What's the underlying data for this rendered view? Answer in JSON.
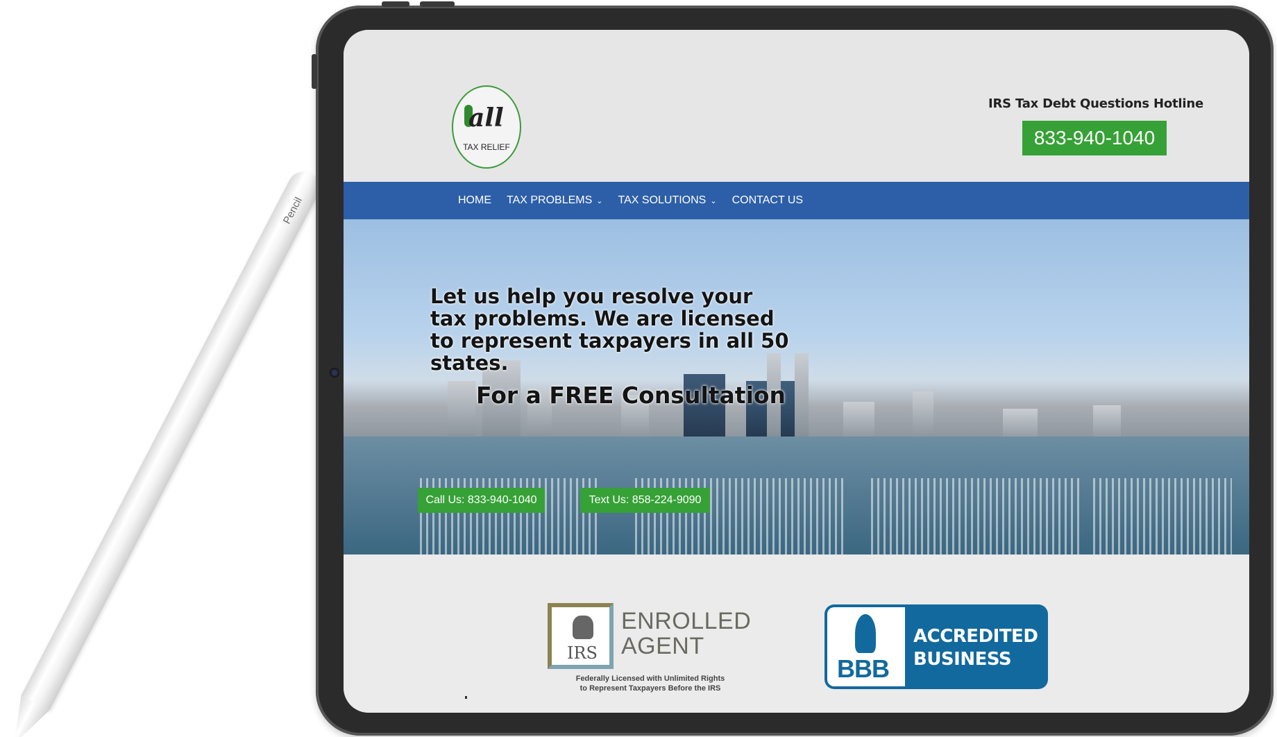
{
  "device": {
    "pencil_label": "Pencil"
  },
  "header": {
    "logo": {
      "script": "all",
      "tagline": "TAX RELIEF"
    },
    "hotline_label": "IRS Tax Debt Questions Hotline",
    "hotline_phone": "833-940-1040"
  },
  "nav": {
    "items": [
      {
        "label": "HOME",
        "dropdown": false
      },
      {
        "label": "TAX PROBLEMS",
        "dropdown": true
      },
      {
        "label": "TAX SOLUTIONS",
        "dropdown": true
      },
      {
        "label": "CONTACT US",
        "dropdown": false
      }
    ]
  },
  "hero": {
    "headline": "Let us help you resolve your tax problems. We are licensed to represent taxpayers in all 50 states.",
    "consult": "For a FREE Consultation",
    "call_button": "Call Us: 833-940-1040",
    "text_button": "Text Us: 858-224-9090"
  },
  "badges": {
    "enrolled_agent": {
      "mark_text": "IRS",
      "title_line1": "ENROLLED",
      "title_line2": "AGENT",
      "subtitle_line1": "Federally Licensed with Unlimited Rights",
      "subtitle_line2": "to Represent Taxpayers Before the IRS"
    },
    "bbb": {
      "mark": "BBB",
      "line1": "ACCREDITED",
      "line2": "BUSINESS"
    }
  },
  "colors": {
    "brand_green": "#36a136",
    "nav_blue": "#2d5fa8",
    "bbb_blue": "#12699e"
  }
}
